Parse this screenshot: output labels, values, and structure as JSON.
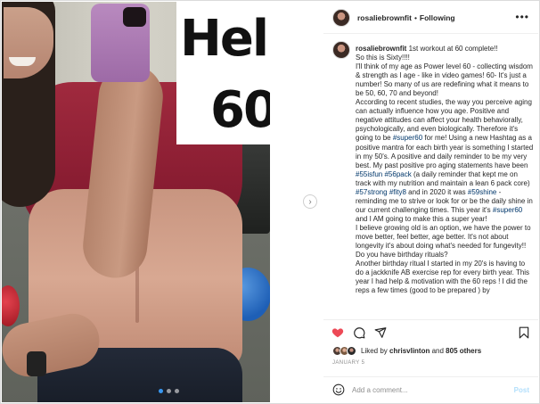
{
  "photo": {
    "overlay_line1": "Hello",
    "overlay_line2": "60",
    "dots": 3,
    "active_dot": 0
  },
  "header": {
    "username": "rosaliebrownfit",
    "separator": "•",
    "follow_status": "Following",
    "more_icon": "more-dots-icon"
  },
  "caption": {
    "username": "rosaliebrownfit",
    "segments": [
      {
        "t": " 1st workout at 60 complete!!\nSo this is Sixty!!!!\nI'll think of my age as Power level 60 - collecting wisdom & strength as I age - like in video games! 60- It's just a number! So many of us are redefining what it means to be 50, 60, 70 and beyond!\nAccording to recent studies, the way you perceive aging can actually influence how you age. Positive and negative attitudes can affect your health behaviorally, psychologically, and even biologically. Therefore it's going to be "
      },
      {
        "t": "#super60",
        "tag": true
      },
      {
        "t": " for me! Using a new Hashtag as a positive mantra for each birth year is something I started in my 50's. A positive and daily reminder to be my very best. My past positive pro aging statements have been "
      },
      {
        "t": "#55isfun",
        "tag": true
      },
      {
        "t": " "
      },
      {
        "t": "#56pack",
        "tag": true
      },
      {
        "t": " (a daily reminder that kept me on track with my nutrition and maintain a lean 6 pack core) "
      },
      {
        "t": "#57strong",
        "tag": true
      },
      {
        "t": " "
      },
      {
        "t": "#fity8",
        "tag": true
      },
      {
        "t": " and in 2020 it was "
      },
      {
        "t": "#59shine",
        "tag": true
      },
      {
        "t": " - reminding me to strive or look for or be the daily shine in our current challenging times. This year it's "
      },
      {
        "t": "#super60",
        "tag": true
      },
      {
        "t": " and I AM going to make this a super year!\nI believe growing old is an option, we have the power to move better, feel better, age better. It's not about longevity it's about doing what's needed for fungevity!! Do you have birthday rituals?\nAnother birthday ritual I started in my 20's is having to do a jackknife AB exercise rep for every birth year. This year I had help & motivation with the 60 reps ! I did the reps a few times (good to be prepared ) by"
      }
    ]
  },
  "actions": {
    "like_icon": "heart-filled-icon",
    "comment_icon": "comment-icon",
    "share_icon": "share-icon",
    "save_icon": "bookmark-icon",
    "like_color": "#ed4956"
  },
  "likes": {
    "prefix": "Liked by ",
    "user": "chrisvlinton",
    "middle": " and ",
    "others": "805 others"
  },
  "date": "JANUARY 5",
  "comment": {
    "placeholder": "Add a comment...",
    "post_label": "Post"
  }
}
